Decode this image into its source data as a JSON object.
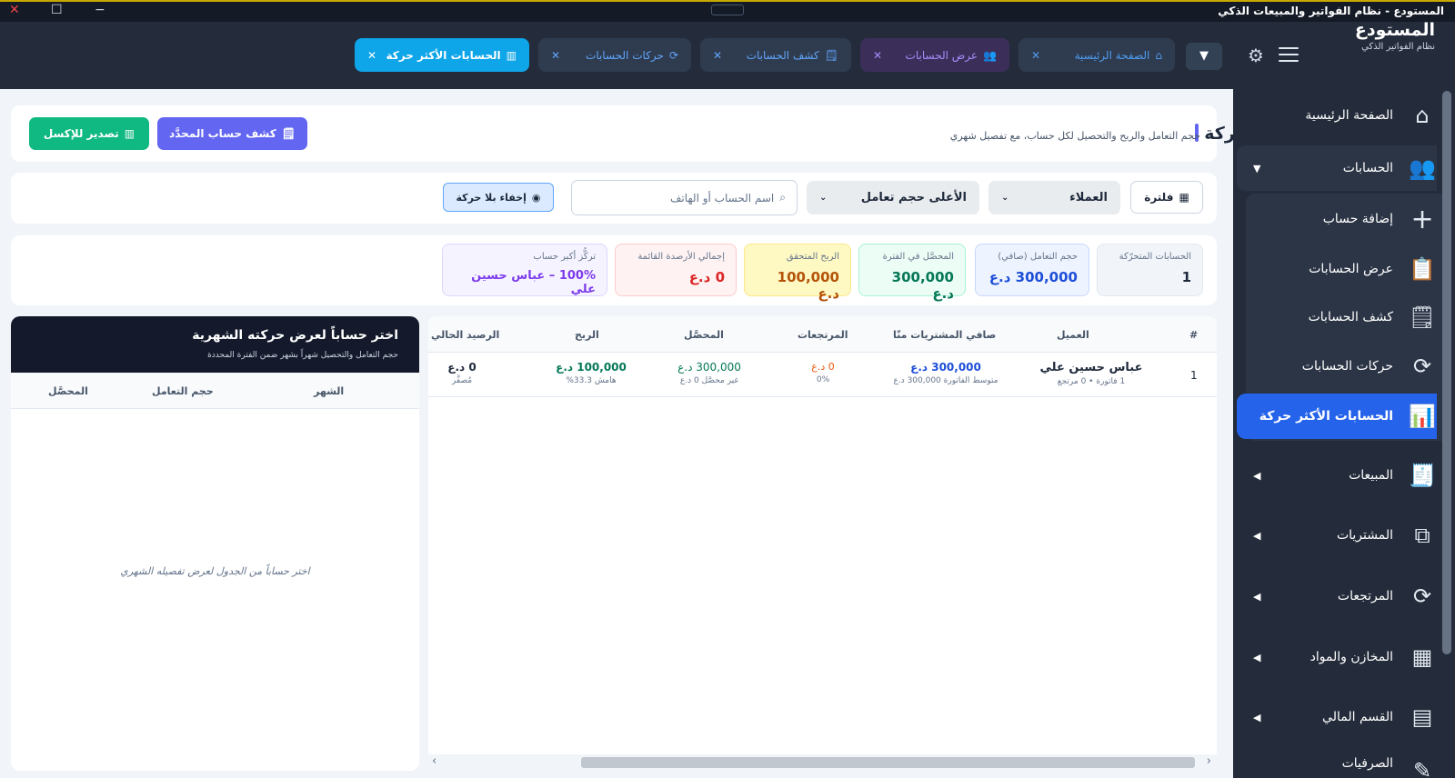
{
  "window": {
    "title": "المستودع - نظام الفواتير والمبيعات الذكي",
    "close": "✕",
    "maximize": "☐",
    "minimize": "−"
  },
  "brand": {
    "name": "المستودع",
    "tagline": "نظام الفواتير الذكي"
  },
  "tabs": [
    {
      "label": "الصفحة الرئيسية",
      "icon": "home-icon"
    },
    {
      "label": "عرض الحسابات",
      "icon": "users-icon"
    },
    {
      "label": "كشف الحسابات",
      "icon": "document-icon"
    },
    {
      "label": "حركات الحسابات",
      "icon": "refresh-icon"
    },
    {
      "label": "الحسابات الأكثر حركة",
      "icon": "chart-icon"
    }
  ],
  "tab_close": "✕",
  "tabs_dropdown": "▼",
  "sidebar": {
    "items": [
      {
        "label": "الصفحة الرئيسية",
        "icon": "⌂"
      },
      {
        "label": "الحسابات",
        "icon": "👥",
        "arrow": "▼"
      },
      {
        "label": "إضافة حساب",
        "icon": "+"
      },
      {
        "label": "عرض الحسابات",
        "icon": "📋"
      },
      {
        "label": "كشف الحسابات",
        "icon": "🗒"
      },
      {
        "label": "حركات الحسابات",
        "icon": "⟳"
      },
      {
        "label": "الحسابات الأكثر حركة",
        "icon": "📊"
      },
      {
        "label": "المبيعات",
        "icon": "🧾",
        "arrow": "◀"
      },
      {
        "label": "المشتريات",
        "icon": "⧉",
        "arrow": "◀"
      },
      {
        "label": "المرتجعات",
        "icon": "⟳",
        "arrow": "◀"
      },
      {
        "label": "المخازن والمواد",
        "icon": "▦",
        "arrow": "◀"
      },
      {
        "label": "القسم المالي",
        "icon": "▤",
        "arrow": "◀"
      },
      {
        "label": "الصرفيات",
        "icon": "✎"
      }
    ]
  },
  "header": {
    "title": "الحسابات الأكثر حركة",
    "subtitle": "حجم التعامل والربح والتحصيل لكل حساب، مع تفصيل شهري",
    "statement_button": "كشف حساب المحدَّد",
    "export_button": "تصدير للإكسل"
  },
  "filters": {
    "filter_button": "فلترة",
    "type_select": "العملاء",
    "sort_select": "الأعلى حجم تعامل",
    "search_placeholder": "اسم الحساب أو الهاتف",
    "hide_button": "إخفاء بلا حركة"
  },
  "stats": [
    {
      "label": "الحسابات المتحرّكة",
      "value": "1"
    },
    {
      "label": "حجم التعامل (صافي)",
      "value": "300,000 د.ع"
    },
    {
      "label": "المحصَّل في الفترة",
      "value": "300,000 د.ع"
    },
    {
      "label": "الربح المتحقق",
      "value": "100,000 د.ع"
    },
    {
      "label": "إجمالي الأرصدة القائمة",
      "value": "0 د.ع"
    },
    {
      "label": "تركُّز أكبر حساب",
      "value": "100% – عباس حسين علي"
    }
  ],
  "table": {
    "headers": [
      "#",
      "العميل",
      "صافي المشتريات منّا",
      "المرتجعات",
      "المحصَّل",
      "الربح",
      "الرصيد الحالي"
    ],
    "rows": [
      {
        "num": "1",
        "name": "عباس حسين علي",
        "name_sub": "1 فاتورة • 0 مرتجع",
        "net": "300,000 د.ع",
        "net_sub": "متوسط الفاتورة 300,000 د.ع",
        "returns": "0 د.ع",
        "returns_sub": "0%",
        "collected": "300,000 د.ع",
        "collected_sub": "غير محصَّل 0 د.ع",
        "profit": "100,000 د.ع",
        "profit_sub": "هامش 33.3%",
        "balance": "0 د.ع",
        "balance_sub": "مُصفَّر"
      }
    ]
  },
  "monthly": {
    "title": "اختر حساباً لعرض حركته الشهرية",
    "subtitle": "حجم التعامل والتحصيل شهراً بشهر ضمن الفترة المحددة",
    "headers": [
      "الشهر",
      "حجم التعامل",
      "المحصَّل"
    ],
    "empty": "اختر حساباً من الجدول لعرض تفصيله الشهري"
  },
  "scroll": {
    "left": "‹",
    "right": "›"
  }
}
